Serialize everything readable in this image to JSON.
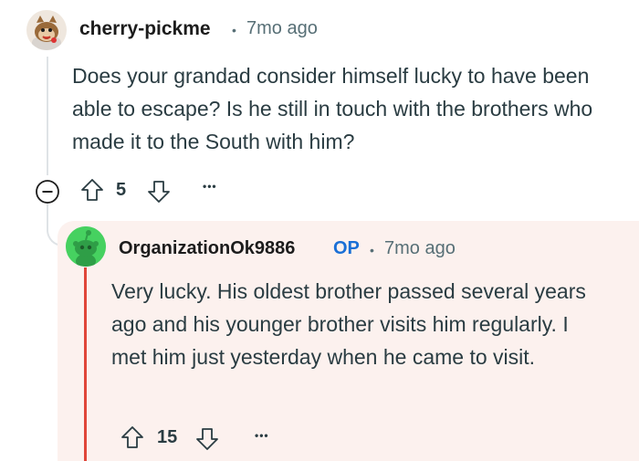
{
  "comments": [
    {
      "username": "cherry-pickme",
      "separator": "•",
      "time": "7mo ago",
      "body": "Does your grandad consider himself lucky to have been able to escape? Is he still in touch with the brothers who made it to the South with him?",
      "votes": "5",
      "more": "•••"
    },
    {
      "username": "OrganizationOk9886",
      "op_badge": "OP",
      "separator": "•",
      "time": "7mo ago",
      "body": "Very lucky. His oldest brother passed several years ago and his younger brother visits him regularly. I met him just yesterday when he came to visit.",
      "votes": "15",
      "more": "•••"
    }
  ],
  "icons": {
    "collapse": "collapse-minus-icon",
    "upvote": "arrow-up-icon",
    "downvote": "arrow-down-icon",
    "overflow": "more-dots-icon"
  },
  "colors": {
    "op_badge": "#1a6fd6",
    "op_bar": "#e0463a",
    "reply_background": "#fcf1ee",
    "thread_line": "#dfe3e6",
    "avatar_green": "#46d160"
  }
}
